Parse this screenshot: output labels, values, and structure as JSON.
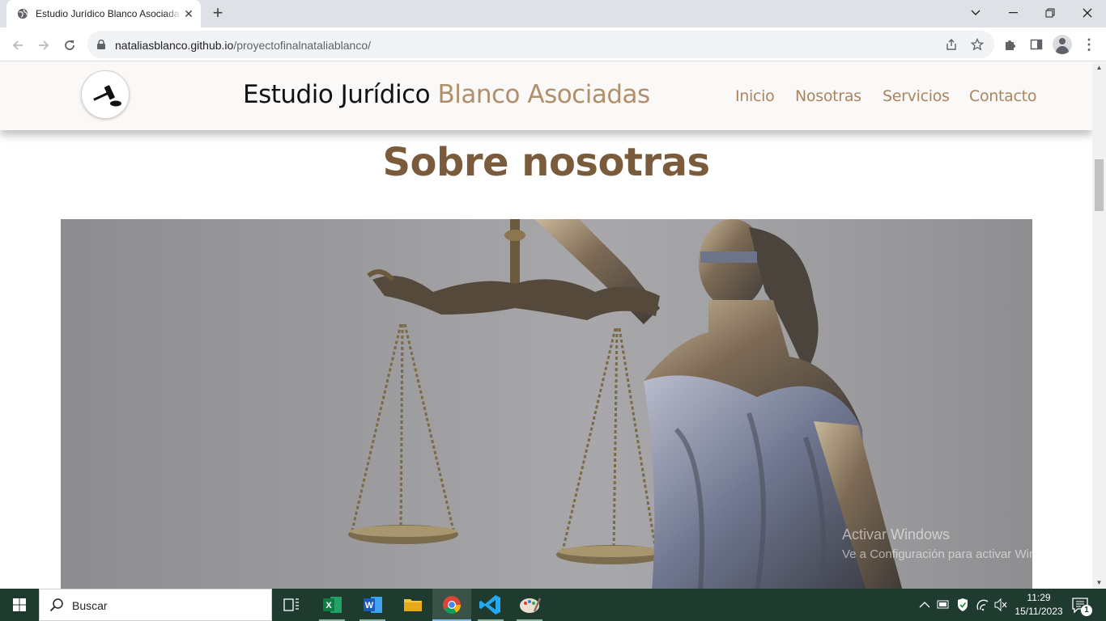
{
  "browser": {
    "tab_title": "Estudio Jurídico Blanco Asociadas",
    "url_host": "nataliasblanco.github.io",
    "url_path": "/proyectofinalnataliablanco/"
  },
  "site": {
    "title_main": "Estudio Jurídico ",
    "title_accent": "Blanco Asociadas",
    "nav": [
      "Inicio",
      "Nosotras",
      "Servicios",
      "Contacto"
    ],
    "section_title": "Sobre nosotras",
    "hero_image": "lady-justice-statue-with-scales",
    "watermark_line1": "Activar Windows",
    "watermark_line2": "Ve a Configuración para activar Windows."
  },
  "taskbar": {
    "search_placeholder": "Buscar",
    "apps": [
      "task-view",
      "excel",
      "word",
      "file-explorer",
      "chrome",
      "vscode",
      "paint"
    ],
    "time": "11:29",
    "date": "15/11/2023",
    "notification_count": "1"
  },
  "colors": {
    "accent": "#b0906a",
    "section_title": "#7a5c3d",
    "taskbar": "#1f3b2f",
    "header_bg": "#fbf9f7"
  }
}
